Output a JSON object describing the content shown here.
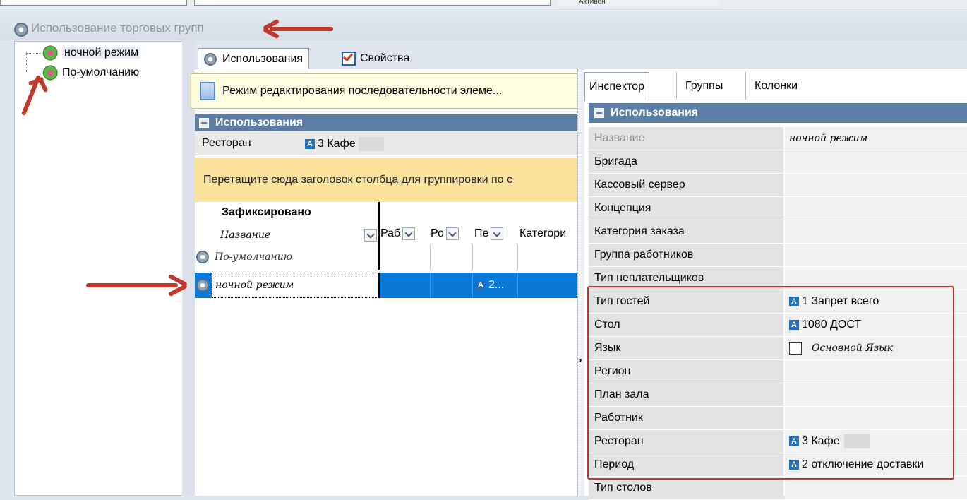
{
  "window": {
    "title": "Использование торговых групп",
    "top_fragment": "Активен"
  },
  "tree": {
    "items": [
      {
        "label": "ночной режим"
      },
      {
        "label": "По-умолчанию"
      }
    ]
  },
  "tabs": [
    {
      "label": "Использования",
      "active": true
    },
    {
      "label": "Свойства",
      "active": false
    }
  ],
  "grid": {
    "edit_mode_text": "Режим редактирования последовательности элеме...",
    "group_header": "Использования",
    "restaurant_label": "Ресторан",
    "restaurant_value": "3 Кафе",
    "drag_hint": "Перетащите сюда заголовок столбца для группировки по с",
    "fixed_header": "Зафиксировано",
    "columns": [
      "Название",
      "Раб",
      "Ро",
      "Пе",
      "Категори"
    ],
    "rows": [
      {
        "name": "По-умолчанию",
        "pe": "",
        "selected": false
      },
      {
        "name": "ночной режим",
        "pe": "2...",
        "selected": true
      }
    ]
  },
  "inspector": {
    "tabs": [
      "Инспектор",
      "Группы",
      "Колонки"
    ],
    "group_header": "Использования",
    "properties": [
      {
        "name": "Название",
        "value": "ночной режим",
        "dim": true,
        "italic": true
      },
      {
        "name": "Бригада",
        "value": ""
      },
      {
        "name": "Кассовый сервер",
        "value": ""
      },
      {
        "name": "Концепция",
        "value": ""
      },
      {
        "name": "Категория заказа",
        "value": ""
      },
      {
        "name": "Группа работников",
        "value": ""
      },
      {
        "name": "Тип неплательщиков",
        "value": ""
      },
      {
        "name": "Тип гостей",
        "value": "1 Запрет всего",
        "icon": true
      },
      {
        "name": "Стол",
        "value": "1080 ДОСТ",
        "icon": true
      },
      {
        "name": "Язык",
        "value": "Основной Язык",
        "checkbox": true,
        "italic": true
      },
      {
        "name": "Регион",
        "value": ""
      },
      {
        "name": "План зала",
        "value": ""
      },
      {
        "name": "Работник",
        "value": ""
      },
      {
        "name": "Ресторан",
        "value": "3 Кафе",
        "icon": true,
        "blur": true
      },
      {
        "name": "Период",
        "value": "2 отключение доставки",
        "icon": true
      },
      {
        "name": "Тип столов",
        "value": ""
      }
    ]
  },
  "colors": {
    "group_header_bg": "#5c7da4",
    "selected_row": "#0a7ad9",
    "highlight_box": "#b83a36",
    "annotation_arrow": "#c0392b"
  }
}
